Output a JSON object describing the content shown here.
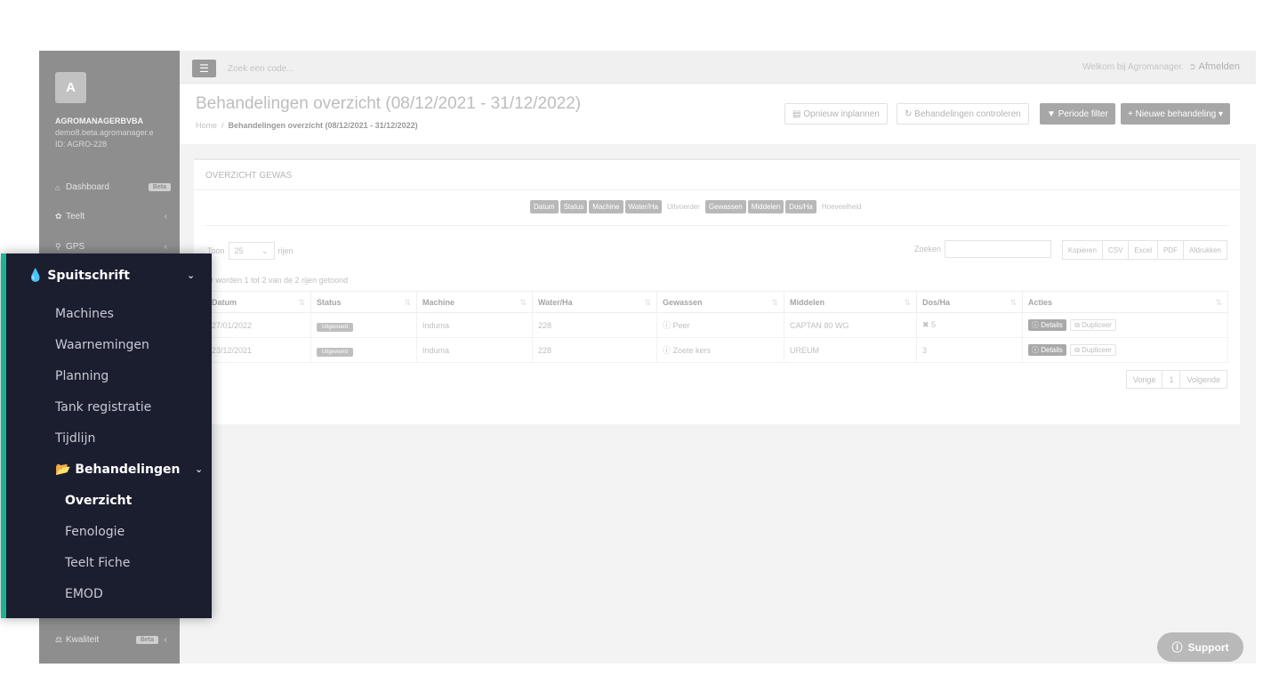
{
  "sidebar": {
    "avatar_letter": "A",
    "company": "AGROMANAGERBVBA",
    "email": "demo8.beta.agromanager.e",
    "id": "ID: AGRO-228",
    "items": [
      {
        "label": "Dashboard",
        "icon": "home-icon",
        "badge": "Beta"
      },
      {
        "label": "Teelt",
        "icon": "leaf-icon"
      },
      {
        "label": "GPS",
        "icon": "map-marker-icon"
      },
      {
        "label": "Kwaliteit",
        "icon": "balance-scale-icon",
        "badge": "Beta"
      }
    ]
  },
  "topbar": {
    "search_placeholder": "Zoek een code...",
    "welcome": "Welkom bij Agromanager.",
    "logout": "Afmelden"
  },
  "header": {
    "title": "Behandelingen overzicht (08/12/2021 - 31/12/2022)",
    "crumb_home": "Home",
    "crumb_current": "Behandelingen overzicht (08/12/2021 - 31/12/2022)",
    "buttons": [
      "Opnieuw inplannen",
      "Behandelingen controleren",
      "Periode filter",
      "+ Nieuwe behandeling"
    ]
  },
  "panel": {
    "title": "OVERZICHT GEWAS",
    "column_toggles": [
      {
        "label": "Datum",
        "on": true
      },
      {
        "label": "Status",
        "on": true
      },
      {
        "label": "Machine",
        "on": true
      },
      {
        "label": "Water/Ha",
        "on": true
      },
      {
        "label": "Uitvoerder",
        "on": false
      },
      {
        "label": "Gewassen",
        "on": true
      },
      {
        "label": "Middelen",
        "on": true
      },
      {
        "label": "Dos/Ha",
        "on": true
      },
      {
        "label": "Hoeveelheid",
        "on": false
      }
    ],
    "show_label": "Toon",
    "show_value": "25",
    "rows_label": "rijen",
    "search_label": "Zoeken",
    "export_buttons": [
      "Kopieren",
      "CSV",
      "Excel",
      "PDF",
      "Afdrukken"
    ],
    "info": "Er worden 1 tot 2 van de 2 rijen getoond",
    "columns": [
      "Datum",
      "Status",
      "Machine",
      "Water/Ha",
      "Gewassen",
      "Middelen",
      "Dos/Ha",
      "Acties"
    ],
    "rows": [
      {
        "datum": "27/01/2022",
        "status": "Uitgevoerd",
        "machine": "Induma",
        "water": "228",
        "gewas": "Peer",
        "middel": "CAPTAN 80 WG",
        "dos": "5",
        "dos_warn": true
      },
      {
        "datum": "23/12/2021",
        "status": "Uitgevoerd",
        "machine": "Induma",
        "water": "228",
        "gewas": "Zoete kers",
        "middel": "UREUM",
        "dos": "3",
        "dos_warn": false
      }
    ],
    "details_label": "Details",
    "duplicate_label": "Dupliceer",
    "pager": [
      "Vorige",
      "1",
      "Volgende"
    ]
  },
  "support_label": "Support",
  "popup_menu": {
    "section": "Spuitschrift",
    "items": [
      "Machines",
      "Waarnemingen",
      "Planning",
      "Tank registratie",
      "Tijdlijn"
    ],
    "submenu": "Behandelingen",
    "subitems": [
      "Overzicht",
      "Fenologie",
      "Teelt Fiche",
      "EMOD"
    ]
  }
}
